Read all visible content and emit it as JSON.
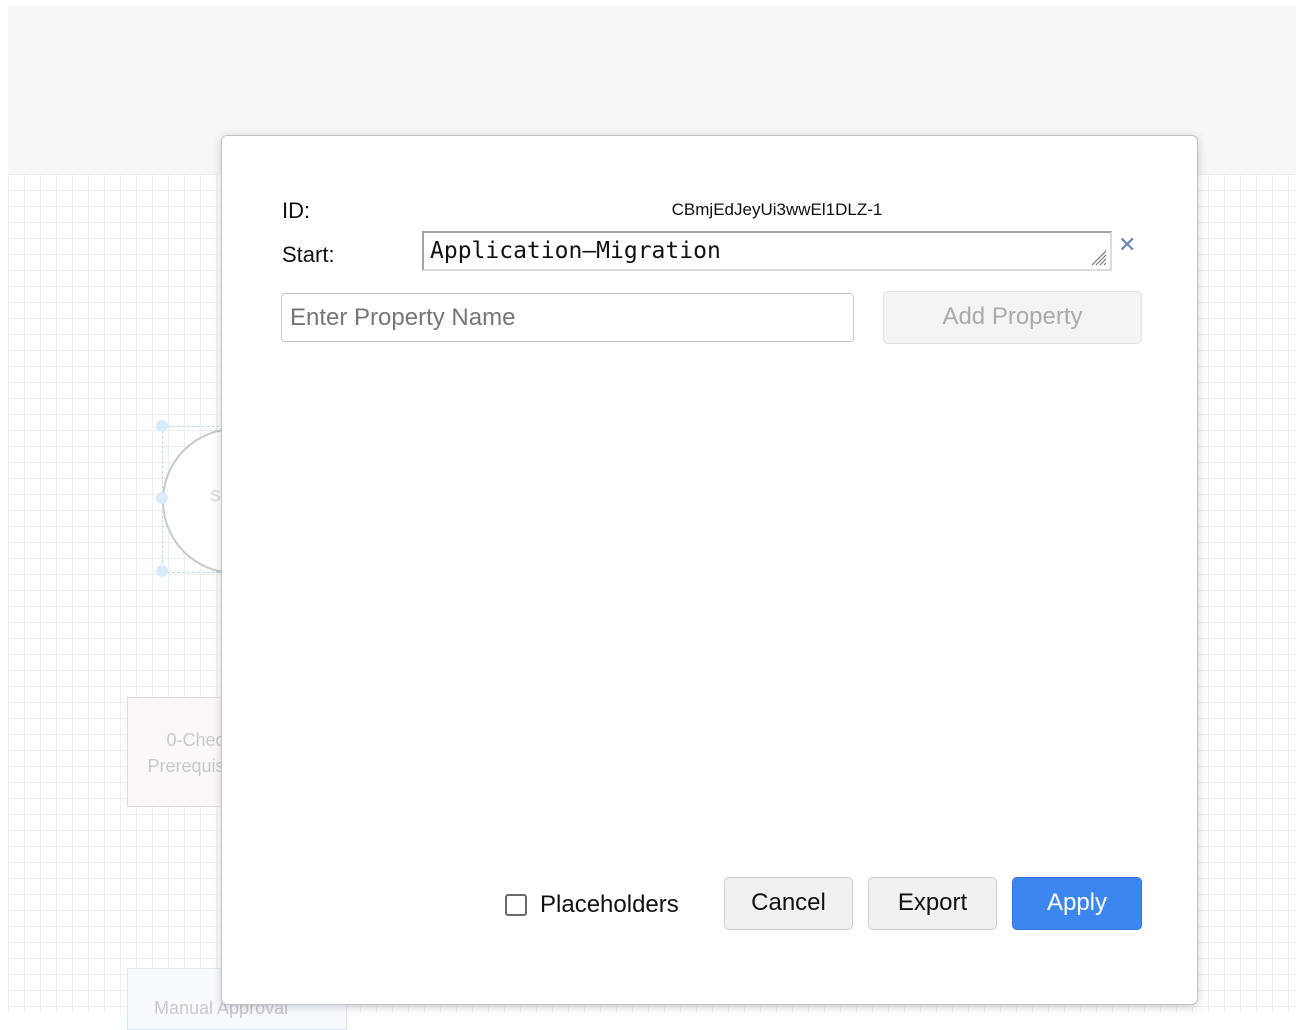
{
  "background": {
    "circle_label": "S",
    "task_label": "0-Check\nPrerequisites",
    "approval_label": "Manual Approval"
  },
  "dialog": {
    "id_label": "ID:",
    "id_value": "CBmjEdJeyUi3wwEl1DLZ-1",
    "start_label": "Start:",
    "start_value": "Application–Migration",
    "clear_icon": "close-icon",
    "property_placeholder": "Enter Property Name",
    "property_value": "",
    "add_property_label": "Add Property",
    "placeholders_label": "Placeholders",
    "placeholders_checked": false,
    "cancel_label": "Cancel",
    "export_label": "Export",
    "apply_label": "Apply"
  },
  "colors": {
    "apply_accent": "#3d86f0",
    "clear_icon": "#6d88b4"
  }
}
